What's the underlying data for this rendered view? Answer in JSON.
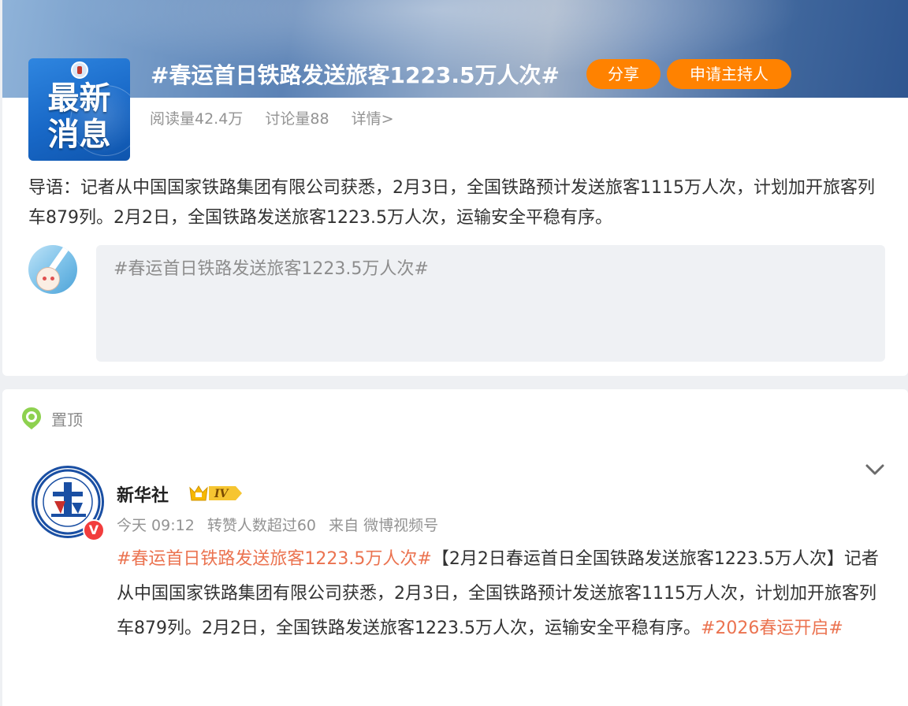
{
  "topic": {
    "cover_text_line1": "最新",
    "cover_text_line2": "消息",
    "title": "#春运首日铁路发送旅客1223.5万人次#",
    "share_label": "分享",
    "host_label": "申请主持人",
    "reads": "阅读量42.4万",
    "discussions": "讨论量88",
    "details_link": "详情>",
    "intro": "导语：记者从中国国家铁路集团有限公司获悉，2月3日，全国铁路预计发送旅客1115万人次，计划加开旅客列车879列。2月2日，全国铁路发送旅客1223.5万人次，运输安全平稳有序。",
    "composer_value": "#春运首日铁路发送旅客1223.5万人次#"
  },
  "feed": {
    "pinned_label": "置顶",
    "post": {
      "author": "新华社",
      "level": "IV",
      "time": "今天 09:12",
      "reposts_note": "转赞人数超过60",
      "source": "来自 微博视频号",
      "tag1": "#春运首日铁路发送旅客1223.5万人次#",
      "text": "【2月2日春运首日全国铁路发送旅客1223.5万人次】记者从中国国家铁路集团有限公司获悉，2月3日，全国铁路预计发送旅客1115万人次，计划加开旅客列车879列。2月2日，全国铁路发送旅客1223.5万人次，运输安全平稳有序。",
      "tag2": "#2026春运开启#",
      "verified_mark": "V"
    }
  },
  "colors": {
    "accent_orange": "#ff8200",
    "topic_tag": "#eb7350",
    "verified_red": "#f23d3d"
  }
}
